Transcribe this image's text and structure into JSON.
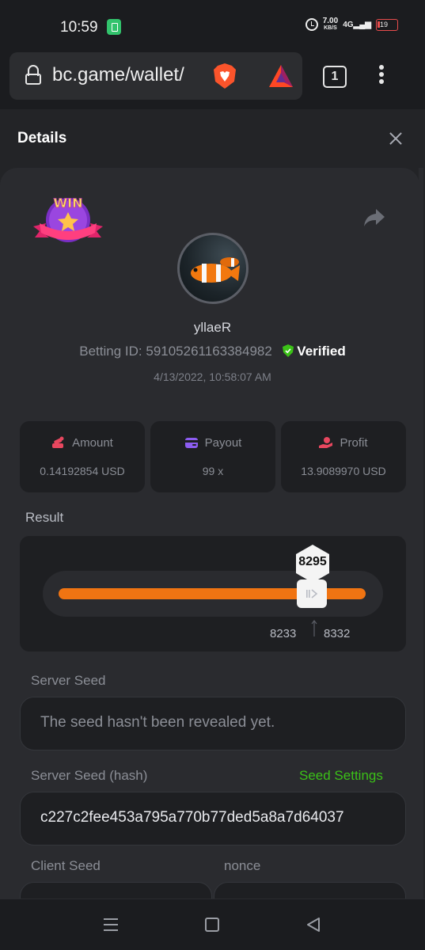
{
  "status_bar": {
    "time": "10:59",
    "net_speed_value": "7.00",
    "net_speed_unit": "KB/S",
    "signal": "4G",
    "battery": "19"
  },
  "browser": {
    "url": "bc.game/wallet/",
    "tab_count": "1"
  },
  "details": {
    "title": "Details",
    "win_badge_text": "WIN",
    "username": "yllaeR",
    "betting_id_label": "Betting ID: 5910526116338498​2",
    "verified_label": "Verified",
    "date": "4/13/2022, 10:58:07 AM"
  },
  "stats": [
    {
      "label": "Amount",
      "value": "0.14192854 USD",
      "icon": "coins-icon",
      "color": "#e8475f"
    },
    {
      "label": "Payout",
      "value": "99 x",
      "icon": "wallet-icon",
      "color": "#8c5cf0"
    },
    {
      "label": "Profit",
      "value": "13.9089970 USD",
      "icon": "hand-coin-icon",
      "color": "#e8475f"
    }
  ],
  "result": {
    "label": "Result",
    "value": "8295",
    "range_low": "8233",
    "range_high": "8332",
    "fill_fraction": 0.9
  },
  "server_seed": {
    "label": "Server Seed",
    "placeholder": "The seed hasn't been revealed yet."
  },
  "server_seed_hash": {
    "label": "Server Seed (hash)",
    "settings_link": "Seed Settings",
    "value": "c227c2fee453a795a770b77ded5a8a7d64037"
  },
  "client_seed": {
    "label": "Client Seed"
  },
  "nonce": {
    "label": "nonce"
  },
  "colors": {
    "accent_green": "#3bc117",
    "slider_orange": "#f07412",
    "card_bg": "#2a2b2f"
  }
}
